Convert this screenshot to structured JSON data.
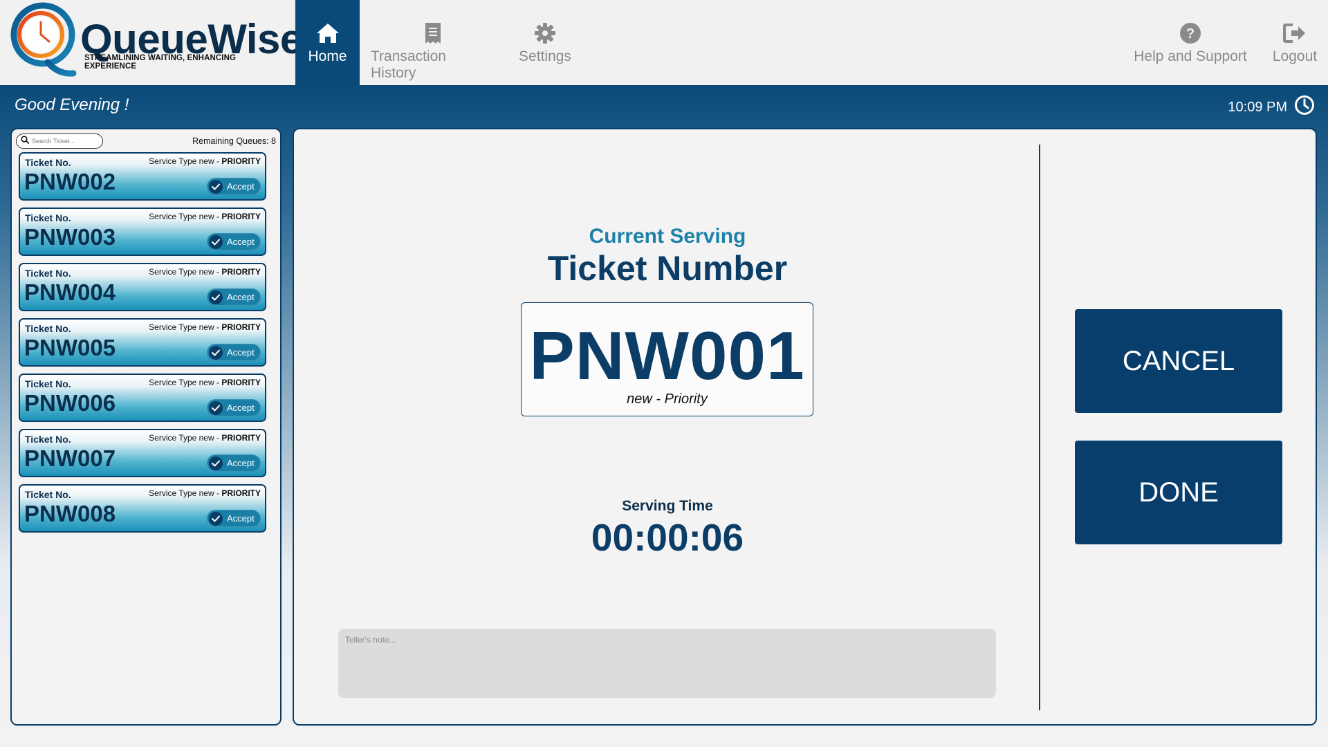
{
  "app": {
    "logo_name": "QueueWise",
    "logo_tagline": "STREAMLINING WAITING, ENHANCING EXPERIENCE"
  },
  "nav": {
    "home": "Home",
    "history": "Transaction History",
    "settings": "Settings",
    "help": "Help and Support",
    "logout": "Logout"
  },
  "header": {
    "greeting": "Good Evening !",
    "time": "10:09 PM"
  },
  "queue": {
    "search_placeholder": "Search Ticket...",
    "remaining_label": "Remaining Queues: 8",
    "ticket_label": "Ticket No.",
    "service_prefix": "Service Type new - ",
    "service_priority": "PRIORITY",
    "accept_label": "Accept",
    "tickets": [
      {
        "number": "PNW002"
      },
      {
        "number": "PNW003"
      },
      {
        "number": "PNW004"
      },
      {
        "number": "PNW005"
      },
      {
        "number": "PNW006"
      },
      {
        "number": "PNW007"
      },
      {
        "number": "PNW008"
      }
    ]
  },
  "serving": {
    "heading": "Current Serving",
    "title": "Ticket Number",
    "ticket": "PNW001",
    "service_type": "new - Priority",
    "time_label": "Serving Time",
    "time": "00:00:06",
    "note_placeholder": "Teller's note..."
  },
  "actions": {
    "cancel": "CANCEL",
    "done": "DONE"
  },
  "colors": {
    "primary": "#0a4a78",
    "accent": "#1d82a8",
    "button": "#083e6b"
  }
}
